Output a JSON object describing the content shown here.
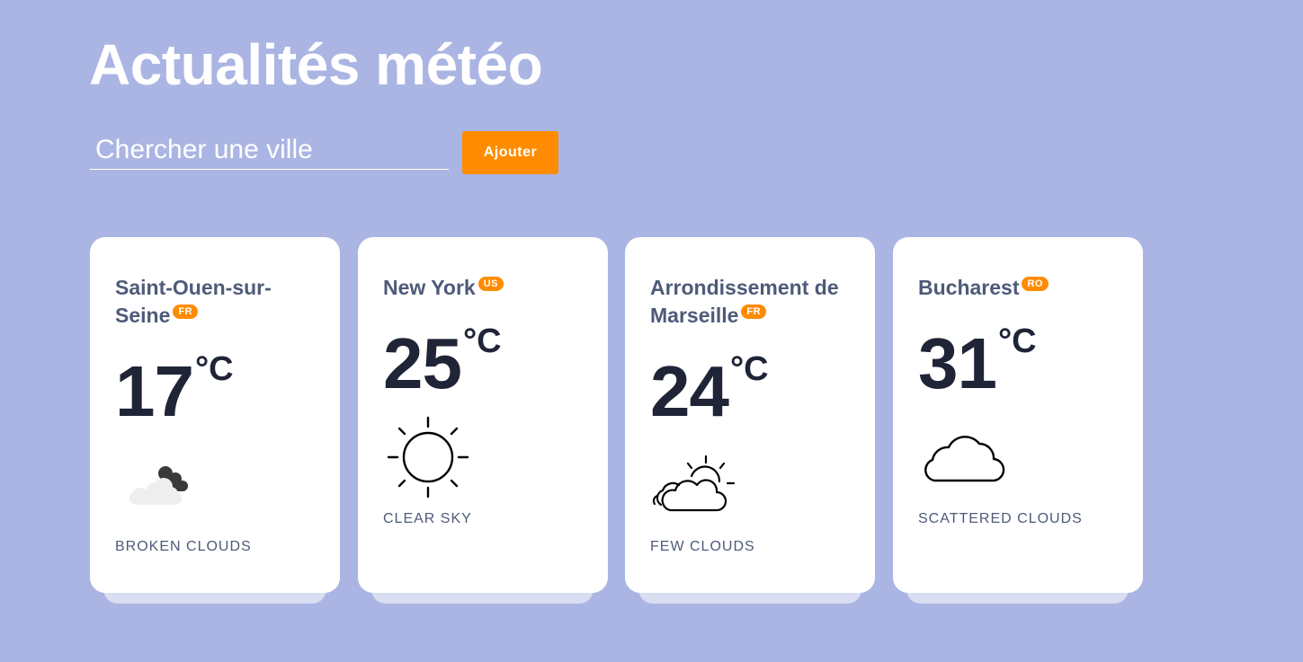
{
  "header": {
    "title": "Actualités météo"
  },
  "search": {
    "placeholder": "Chercher une ville",
    "value": "",
    "button_label": "Ajouter"
  },
  "colors": {
    "background": "#aab5e3",
    "accent": "#ff8c00",
    "card": "#ffffff",
    "city_text": "#4e5a79",
    "temp_text": "#1f2537"
  },
  "cards": [
    {
      "city": "Saint-Ouen-sur-Seine",
      "country": "FR",
      "temperature": "17",
      "unit": "°C",
      "description": "broken clouds",
      "icon": "broken-clouds-icon"
    },
    {
      "city": "New York",
      "country": "US",
      "temperature": "25",
      "unit": "°C",
      "description": "clear sky",
      "icon": "sun-icon"
    },
    {
      "city": "Arrondissement de Marseille",
      "country": "FR",
      "temperature": "24",
      "unit": "°C",
      "description": "few clouds",
      "icon": "few-clouds-icon"
    },
    {
      "city": "Bucharest",
      "country": "RO",
      "temperature": "31",
      "unit": "°C",
      "description": "scattered clouds",
      "icon": "cloud-icon"
    }
  ]
}
